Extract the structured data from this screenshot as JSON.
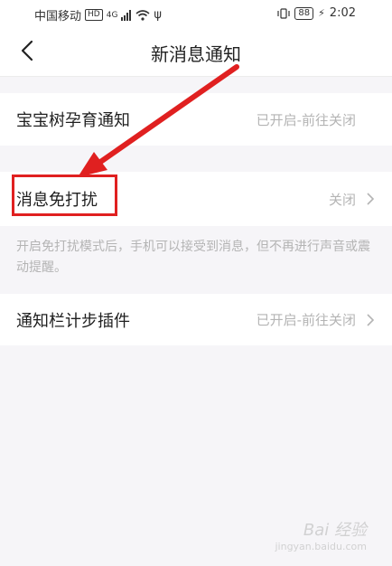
{
  "status_bar": {
    "carrier": "中国移动",
    "hd_badge": "HD",
    "network": "4G",
    "battery": "88",
    "time": "2:02"
  },
  "header": {
    "title": "新消息通知"
  },
  "settings": [
    {
      "label": "宝宝树孕育通知",
      "value": "已开启-前往关闭"
    },
    {
      "label": "消息免打扰",
      "value": "关闭"
    },
    {
      "label": "通知栏计步插件",
      "value": "已开启-前往关闭"
    }
  ],
  "dnd_description": "开启免打扰模式后，手机可以接受到消息，但不再进行声音或震动提醒。",
  "annotation": {
    "color": "#e02020"
  },
  "watermark": {
    "brand": "Bai 经验",
    "url": "jingyan.baidu.com"
  }
}
